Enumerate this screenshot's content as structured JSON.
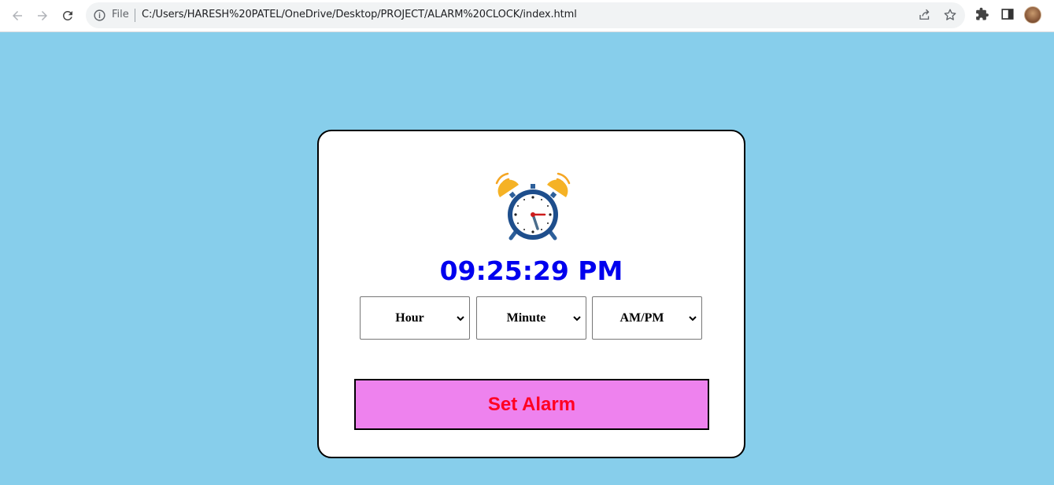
{
  "browser": {
    "file_label": "File",
    "url": "C:/Users/HARESH%20PATEL/OneDrive/Desktop/PROJECT/ALARM%20CLOCK/index.html",
    "icons": [
      "back-arrow-icon",
      "forward-arrow-icon",
      "reload-icon",
      "info-icon",
      "share-icon",
      "star-icon",
      "extensions-icon",
      "side-panel-icon",
      "profile-avatar"
    ]
  },
  "app": {
    "background_color": "#87ceeb",
    "clock_icon": "alarm-clock-icon",
    "current_time": "09:25:29 PM",
    "selects": {
      "hour": "Hour",
      "minute": "Minute",
      "ampm": "AM/PM"
    },
    "set_alarm_label": "Set Alarm",
    "colors": {
      "time_text": "#0000ee",
      "button_bg": "#ee82ee",
      "button_text": "#ff0022"
    }
  }
}
